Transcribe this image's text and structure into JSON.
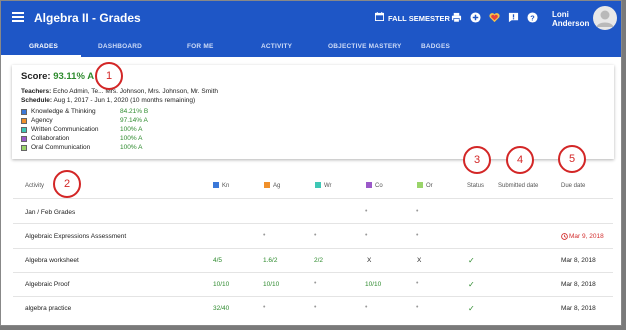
{
  "app": {
    "title": "Algebra II - Grades",
    "semester": "FALL SEMESTER",
    "user_name": "Loni Anderson"
  },
  "tabs": [
    {
      "label": "GRADES",
      "active": true
    },
    {
      "label": "DASHBOARD"
    },
    {
      "label": "FOR ME"
    },
    {
      "label": "ACTIVITY"
    },
    {
      "label": "OBJECTIVE MASTERY"
    },
    {
      "label": "BADGES"
    }
  ],
  "score_card": {
    "label": "Score:",
    "value": "93.11% A",
    "teachers_label": "Teachers:",
    "teachers": "Echo Admin, Te... Mrs. Johnson, Mrs. Johnson, Mr. Smith",
    "schedule_label": "Schedule:",
    "schedule": "Aug 1, 2017 - Jun 1, 2020 (10 months remaining)",
    "objectives": [
      {
        "name": "Knowledge & Thinking",
        "score": "84.21% B",
        "color": "#3b78d8"
      },
      {
        "name": "Agency",
        "score": "97.14% A",
        "color": "#f0902a"
      },
      {
        "name": "Written Communication",
        "score": "100% A",
        "color": "#3ec7b5"
      },
      {
        "name": "Collaboration",
        "score": "100% A",
        "color": "#9b59c9"
      },
      {
        "name": "Oral Communication",
        "score": "100% A",
        "color": "#9ad46a"
      }
    ]
  },
  "table": {
    "headers": {
      "activity": "Activity",
      "kn": "Kn",
      "ag": "Ag",
      "wr": "Wr",
      "co": "Co",
      "or": "Or",
      "status": "Status",
      "submitted": "Submitted date",
      "due": "Due date"
    },
    "rows": [
      {
        "activity": "Jan / Feb Grades",
        "kn": "",
        "ag": "",
        "wr": "",
        "co": "•",
        "or": "•",
        "status": "",
        "due": "",
        "due_overdue": false
      },
      {
        "activity": "Algebraic Expressions Assessment",
        "kn": "",
        "ag": "•",
        "wr": "•",
        "co": "•",
        "or": "•",
        "status": "",
        "due": "Mar 9, 2018",
        "due_overdue": true
      },
      {
        "activity": "Algebra worksheet",
        "kn": "4/5",
        "ag": "1.6/2",
        "wr": "2/2",
        "co": "X",
        "or": "X",
        "status": "✓",
        "due": "Mar 8, 2018",
        "due_overdue": false
      },
      {
        "activity": "Algebraic Proof",
        "kn": "10/10",
        "ag": "10/10",
        "wr": "•",
        "co": "10/10",
        "or": "•",
        "status": "✓",
        "due": "Mar 8, 2018",
        "due_overdue": false
      },
      {
        "activity": "algebra practice",
        "kn": "32/40",
        "ag": "•",
        "wr": "•",
        "co": "•",
        "or": "•",
        "status": "✓",
        "due": "Mar 8, 2018",
        "due_overdue": false
      }
    ]
  },
  "callouts": [
    "1",
    "2",
    "3",
    "4",
    "5"
  ],
  "colors": {
    "appbar": "#1e56c6",
    "score_green": "#2e8b2e",
    "overdue_red": "#d32f2f",
    "callout_red": "#d32626"
  }
}
